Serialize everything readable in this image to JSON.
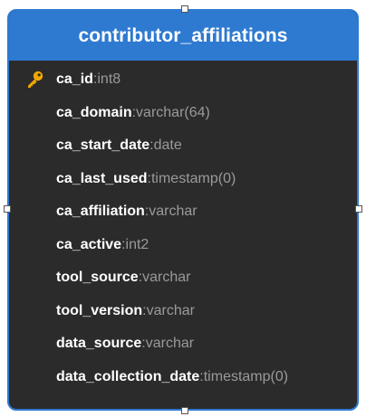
{
  "table": {
    "name": "contributor_affiliations",
    "colors": {
      "header": "#2e7ad1",
      "body": "#2b2b2b",
      "key": "#f0a800"
    },
    "columns": [
      {
        "name": "ca_id",
        "type": "int8",
        "primary_key": true
      },
      {
        "name": "ca_domain",
        "type": "varchar(64)",
        "primary_key": false
      },
      {
        "name": "ca_start_date",
        "type": "date",
        "primary_key": false
      },
      {
        "name": "ca_last_used",
        "type": "timestamp(0)",
        "primary_key": false
      },
      {
        "name": "ca_affiliation",
        "type": "varchar",
        "primary_key": false
      },
      {
        "name": "ca_active",
        "type": "int2",
        "primary_key": false
      },
      {
        "name": "tool_source",
        "type": "varchar",
        "primary_key": false
      },
      {
        "name": "tool_version",
        "type": "varchar",
        "primary_key": false
      },
      {
        "name": "data_source",
        "type": "varchar",
        "primary_key": false
      },
      {
        "name": "data_collection_date",
        "type": "timestamp(0)",
        "primary_key": false
      }
    ],
    "separator": ": ",
    "key_icon": "key-icon"
  }
}
